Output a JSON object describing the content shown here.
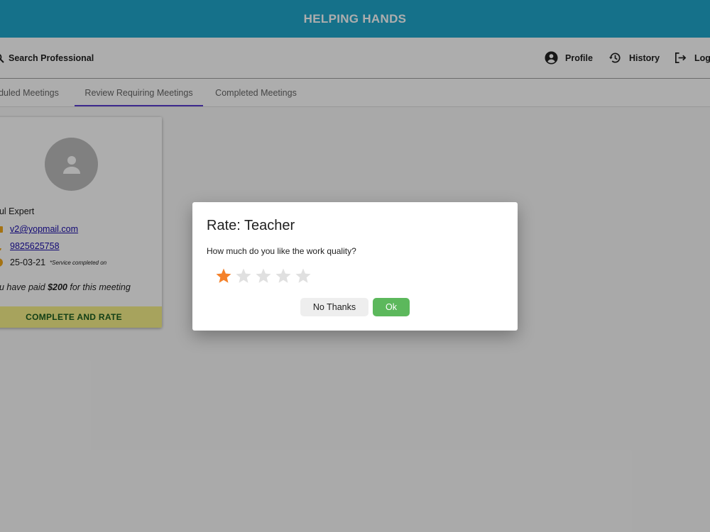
{
  "app": {
    "title": "HELPING HANDS"
  },
  "toolbar": {
    "search_label": "Search Professional",
    "profile_label": "Profile",
    "history_label": "History",
    "logout_label": "Logo"
  },
  "tabs": [
    {
      "label": "eduled Meetings"
    },
    {
      "label": "Review Requiring Meetings",
      "active": true
    },
    {
      "label": "Completed Meetings"
    }
  ],
  "card": {
    "name": "oul Expert",
    "email": "v2@yopmail.com",
    "phone": "9825625758",
    "date": "25-03-21",
    "date_note": "*Service completed on",
    "paid_prefix": "ou have paid ",
    "paid_amount": "$200",
    "paid_suffix": " for this meeting",
    "action_label": "COMPLETE AND RATE"
  },
  "dialog": {
    "title": "Rate: Teacher",
    "question": "How much do you like the work quality?",
    "rating": 1,
    "max_rating": 5,
    "no_thanks_label": "No Thanks",
    "ok_label": "Ok"
  },
  "colors": {
    "app_bar": "#1fa7cc",
    "tab_indicator": "#5b3fd1",
    "action_bg": "#f7f08a",
    "action_text": "#1b5e20",
    "ok_button": "#5cb85c",
    "star_filled": "#f4812a",
    "star_empty": "#e0e0e0"
  }
}
